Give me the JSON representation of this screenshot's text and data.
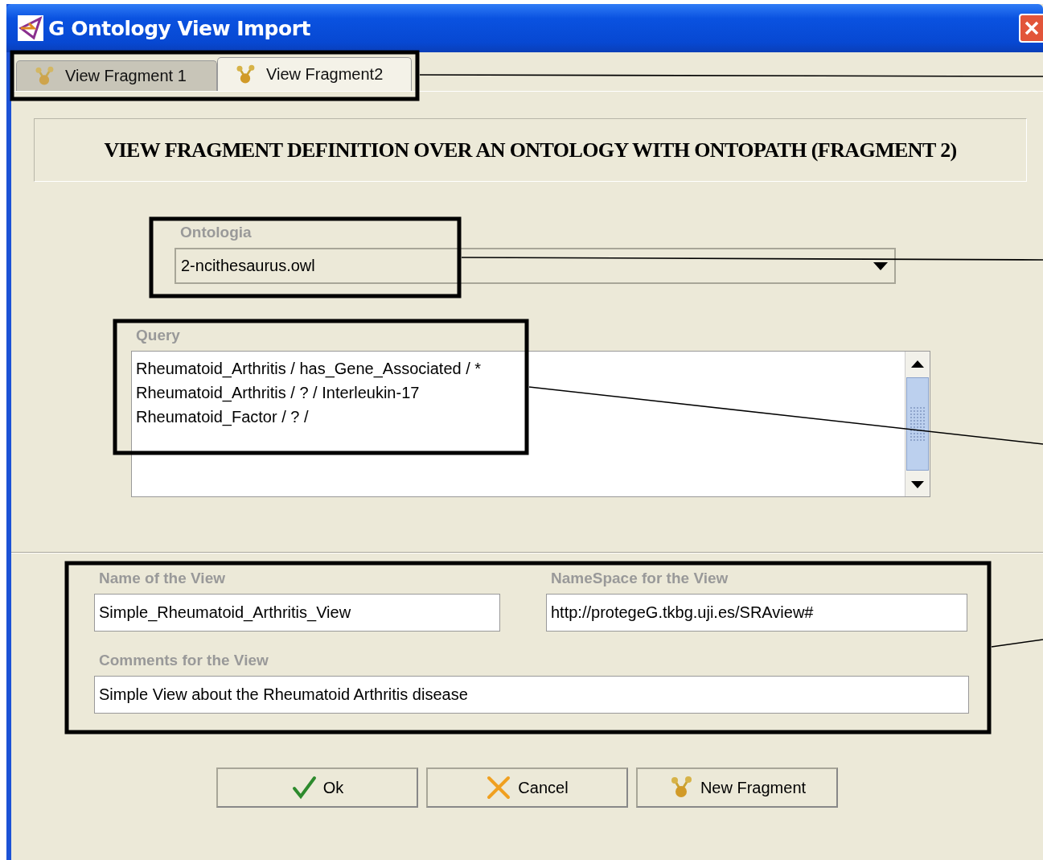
{
  "window": {
    "title": "G Ontology View Import"
  },
  "tabs": [
    {
      "label": "View Fragment 1",
      "selected": false
    },
    {
      "label": "View Fragment2",
      "selected": true
    }
  ],
  "heading": "VIEW FRAGMENT DEFINITION OVER AN ONTOLOGY WITH ONTOPATH (FRAGMENT 2)",
  "ontology": {
    "label": "Ontologia",
    "value": "2-ncithesaurus.owl"
  },
  "query": {
    "label": "Query",
    "lines": [
      "Rheumatoid_Arthritis / has_Gene_Associated / *",
      "Rheumatoid_Arthritis / ? / Interleukin-17",
      "Rheumatoid_Factor / ? /"
    ]
  },
  "view_name": {
    "label": "Name of the View",
    "value": "Simple_Rheumatoid_Arthritis_View"
  },
  "namespace": {
    "label": "NameSpace for the View",
    "value": "http://protegeG.tkbg.uji.es/SRAview#"
  },
  "comments": {
    "label": "Comments for the View",
    "value": "Simple View about the Rheumatoid Arthritis disease"
  },
  "buttons": [
    {
      "label": "Ok",
      "kind": "ok"
    },
    {
      "label": "Cancel",
      "kind": "cancel"
    },
    {
      "label": "New Fragment",
      "kind": "fragment"
    }
  ]
}
